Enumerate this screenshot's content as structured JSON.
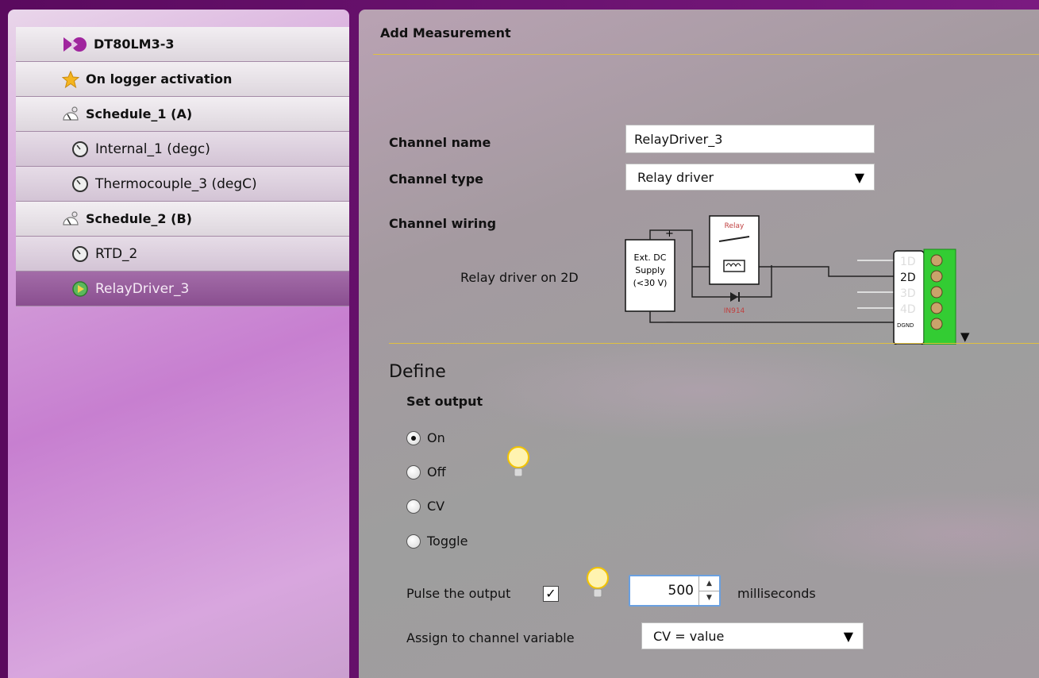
{
  "sidebar": {
    "items": [
      {
        "label": "DT80LM3-3",
        "icon": "logger-icon"
      },
      {
        "label": "On logger activation",
        "icon": "star-icon"
      },
      {
        "label": "Schedule_1 (A)",
        "icon": "schedule-icon"
      },
      {
        "label": "Internal_1 (degc)",
        "icon": "gauge-icon"
      },
      {
        "label": "Thermocouple_3 (degC)",
        "icon": "gauge-icon"
      },
      {
        "label": "Schedule_2 (B)",
        "icon": "schedule-icon"
      },
      {
        "label": "RTD_2",
        "icon": "gauge-icon"
      },
      {
        "label": "RelayDriver_3",
        "icon": "relay-icon",
        "selected": true
      }
    ]
  },
  "main": {
    "title": "Add Measurement",
    "channel_name": {
      "label": "Channel name",
      "value": "RelayDriver_3"
    },
    "channel_type": {
      "label": "Channel type",
      "value": "Relay driver"
    },
    "channel_wiring": {
      "label": "Channel wiring",
      "caption": "Relay driver on 2D",
      "diagram": {
        "supply_line1": "Ext. DC",
        "supply_line2": "Supply",
        "supply_line3": "(<30 V)",
        "plus": "+",
        "minus": "−",
        "relay": "Relay",
        "diode": "IN914",
        "terminals": [
          "1D",
          "2D",
          "3D",
          "4D",
          "DGND"
        ]
      }
    },
    "define": {
      "heading": "Define",
      "set_output_label": "Set output",
      "options": [
        "On",
        "Off",
        "CV",
        "Toggle"
      ],
      "selected_option": "On",
      "pulse_label": "Pulse the output",
      "pulse_checked": "✓",
      "pulse_value": "500",
      "pulse_units": "milliseconds",
      "assign_label": "Assign to channel variable",
      "assign_value": "CV = value"
    }
  },
  "colors": {
    "accent_line": "#e0c040",
    "selected_item": "#8a4f90",
    "terminal_green": "#33cc33"
  }
}
